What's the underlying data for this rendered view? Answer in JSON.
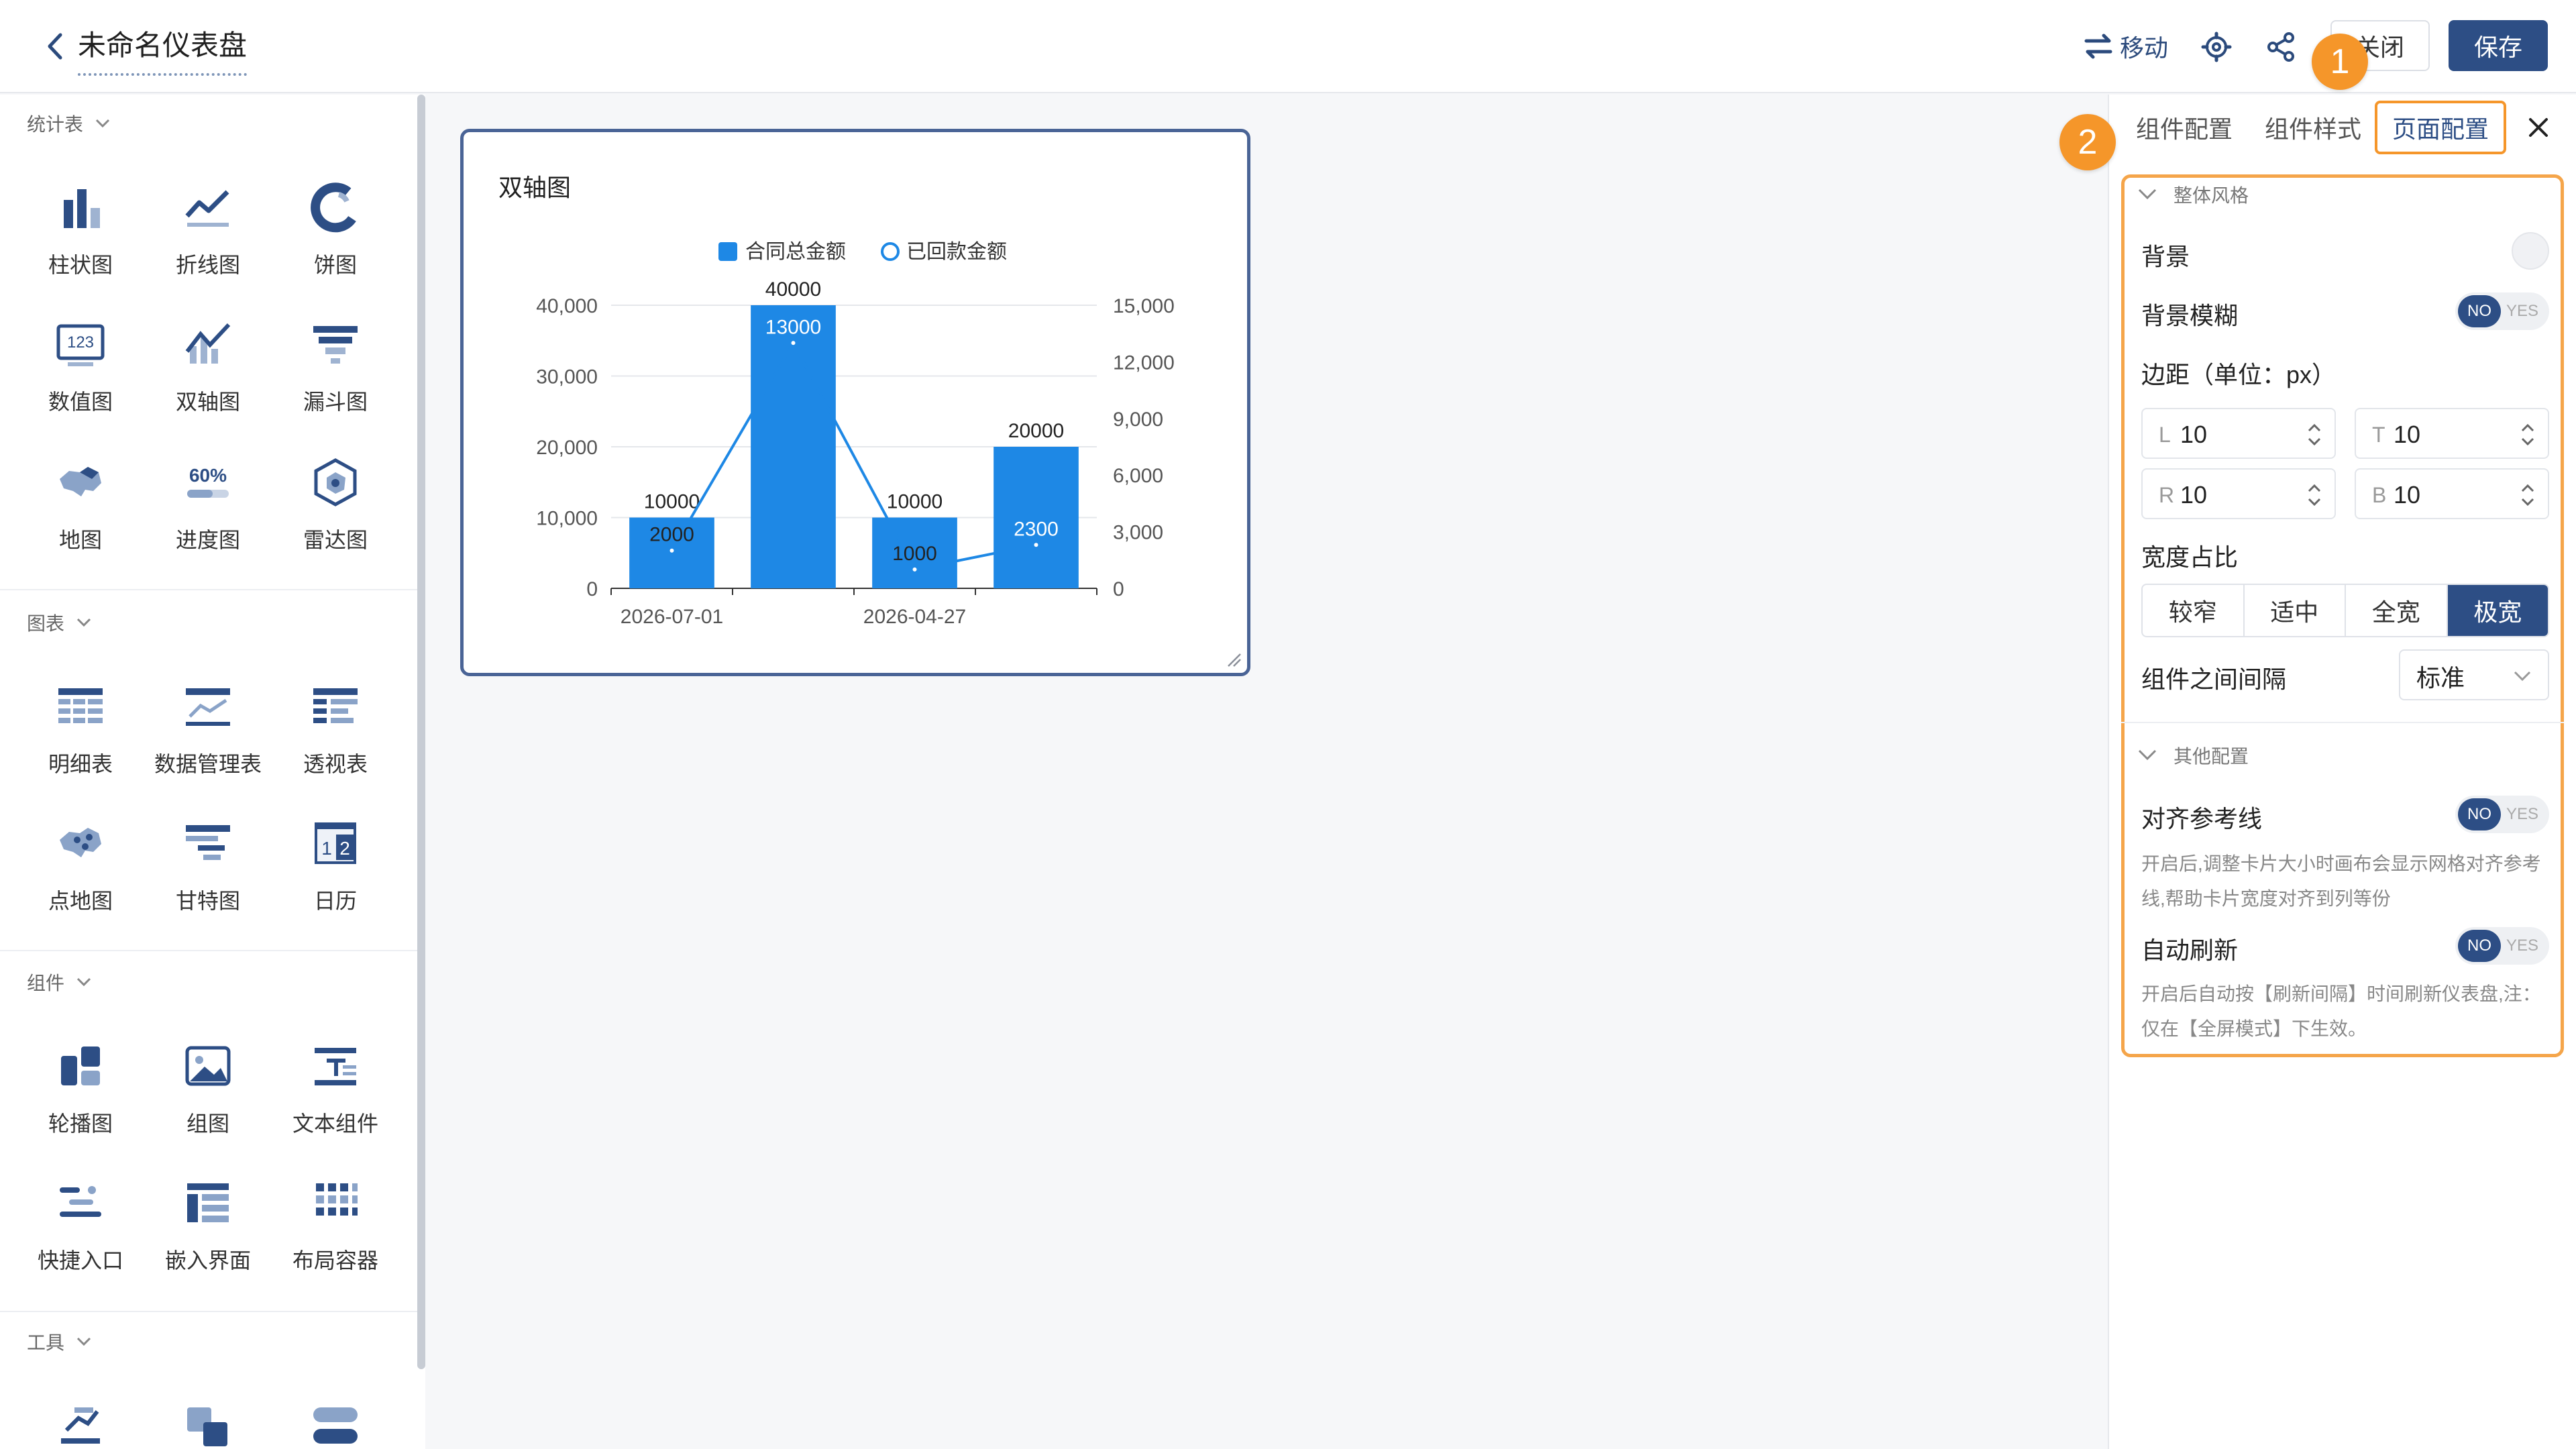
{
  "header": {
    "dashboard_title": "未命名仪表盘",
    "move_label": "移动",
    "close_label": "关闭",
    "save_label": "保存"
  },
  "markers": {
    "m1": "1",
    "m2": "2"
  },
  "sidebar": {
    "sections": [
      {
        "title": "统计表",
        "items": [
          "柱状图",
          "折线图",
          "饼图",
          "数值图",
          "双轴图",
          "漏斗图",
          "地图",
          "进度图",
          "雷达图"
        ]
      },
      {
        "title": "图表",
        "items": [
          "明细表",
          "数据管理表",
          "透视表",
          "点地图",
          "甘特图",
          "日历"
        ]
      },
      {
        "title": "组件",
        "items": [
          "轮播图",
          "组图",
          "文本组件",
          "快捷入口",
          "嵌入界面",
          "布局容器"
        ]
      },
      {
        "title": "工具",
        "items": []
      }
    ],
    "icon_text": {
      "value_icon": "123",
      "progress_icon": "60%",
      "calendar_a": "1",
      "calendar_b": "2"
    }
  },
  "card": {
    "title": "双轴图"
  },
  "chart_data": {
    "type": "bar",
    "title": "",
    "legend": [
      "合同总金额",
      "已回款金额"
    ],
    "legend_position": "top",
    "categories": [
      "2026-07-01",
      "",
      "2026-04-27",
      ""
    ],
    "x_tick_labels": [
      "2026-07-01",
      "2026-04-27"
    ],
    "series": [
      {
        "name": "合同总金额",
        "type": "bar",
        "axis": "left",
        "values": [
          10000,
          40000,
          10000,
          20000
        ],
        "labels": [
          "10000",
          "40000",
          "10000",
          "20000"
        ]
      },
      {
        "name": "已回款金额",
        "type": "line",
        "axis": "right",
        "values": [
          2000,
          13000,
          1000,
          2300
        ],
        "labels": [
          "2000",
          "13000",
          "1000",
          "2300"
        ]
      }
    ],
    "y_left": {
      "ticks": [
        "0",
        "10,000",
        "20,000",
        "30,000",
        "40,000"
      ],
      "range": [
        0,
        40000
      ]
    },
    "y_right": {
      "ticks": [
        "0",
        "3,000",
        "6,000",
        "9,000",
        "12,000",
        "15,000"
      ],
      "range": [
        0,
        15000
      ]
    },
    "grid": true,
    "colors": {
      "bar": "#1e88e5",
      "line": "#1e88e5"
    }
  },
  "panel": {
    "tabs": [
      "组件配置",
      "组件样式",
      "页面配置"
    ],
    "active_tab": "页面配置",
    "overall_title": "整体风格",
    "background_label": "背景",
    "blur_label": "背景模糊",
    "margin_label": "边距（单位：px）",
    "margins": {
      "L": "10",
      "T": "10",
      "R": "10",
      "B": "10"
    },
    "margin_prefix": {
      "L": "L",
      "T": "T",
      "R": "R",
      "B": "B"
    },
    "width_label": "宽度占比",
    "width_options": [
      "较窄",
      "适中",
      "全宽",
      "极宽"
    ],
    "width_selected": "极宽",
    "gap_label": "组件之间间隔",
    "gap_value": "标准",
    "other_title": "其他配置",
    "align_label": "对齐参考线",
    "align_help": "开启后,调整卡片大小时画布会显示网格对齐参考线,帮助卡片宽度对齐到列等份",
    "refresh_label": "自动刷新",
    "refresh_help": "开启后自动按【刷新间隔】时间刷新仪表盘,注：仅在【全屏模式】下生效。",
    "toggle_no": "NO",
    "toggle_yes": "YES"
  },
  "colors": {
    "primary": "#2d4e85",
    "accent": "#f5962a",
    "bar": "#1e88e5"
  }
}
